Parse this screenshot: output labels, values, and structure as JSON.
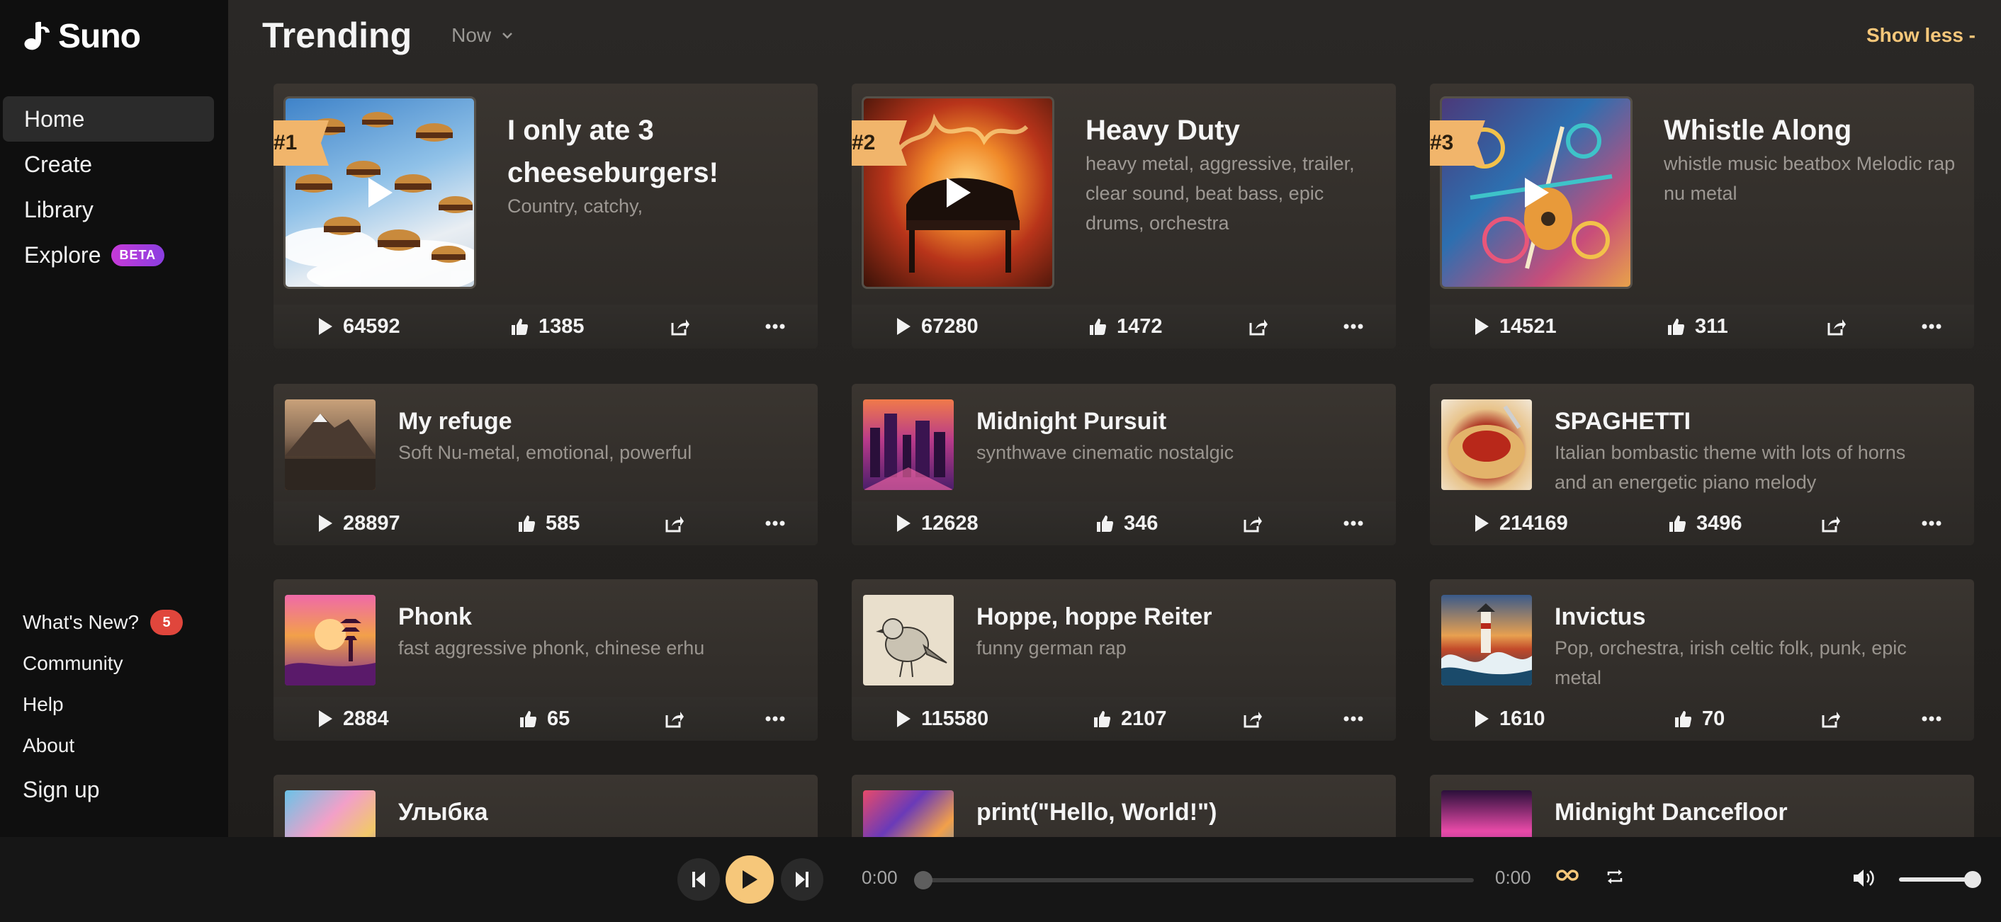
{
  "brand": {
    "name": "Suno"
  },
  "nav": [
    {
      "label": "Home",
      "active": true
    },
    {
      "label": "Create"
    },
    {
      "label": "Library"
    },
    {
      "label": "Explore",
      "badge": "BETA"
    }
  ],
  "footer_nav": {
    "whats_new": "What's New?",
    "whats_new_count": "5",
    "community": "Community",
    "help": "Help",
    "about": "About",
    "sign_up": "Sign up"
  },
  "header": {
    "title": "Trending",
    "filter": "Now",
    "show_less": "Show less -"
  },
  "featured": [
    {
      "rank": "#1",
      "title": "I only ate 3 cheeseburgers!",
      "tags": "Country, catchy,",
      "plays": "64592",
      "likes": "1385"
    },
    {
      "rank": "#2",
      "title": "Heavy Duty",
      "tags": "heavy metal, aggressive, trailer, clear sound, beat bass, epic drums, orchestra",
      "plays": "67280",
      "likes": "1472"
    },
    {
      "rank": "#3",
      "title": "Whistle Along",
      "tags": "whistle music beatbox Melodic rap nu metal",
      "plays": "14521",
      "likes": "311"
    }
  ],
  "songs": [
    {
      "title": "My refuge",
      "tags": "Soft Nu-metal, emotional, powerful",
      "plays": "28897",
      "likes": "585"
    },
    {
      "title": "Midnight Pursuit",
      "tags": "synthwave cinematic nostalgic",
      "plays": "12628",
      "likes": "346"
    },
    {
      "title": "SPAGHETTI",
      "tags": "Italian bombastic theme with lots of horns and an energetic piano melody",
      "plays": "214169",
      "likes": "3496"
    },
    {
      "title": "Phonk",
      "tags": "fast aggressive phonk, chinese erhu",
      "plays": "2884",
      "likes": "65"
    },
    {
      "title": "Hoppe, hoppe Reiter",
      "tags": "funny german rap",
      "plays": "115580",
      "likes": "2107"
    },
    {
      "title": "Invictus",
      "tags": "Pop, orchestra, irish celtic folk, punk, epic metal",
      "plays": "1610",
      "likes": "70"
    },
    {
      "title": "Улыбка",
      "tags": "",
      "plays": "",
      "likes": ""
    },
    {
      "title": "print(\"Hello, World!\")",
      "tags": "",
      "plays": "",
      "likes": ""
    },
    {
      "title": "Midnight Dancefloor",
      "tags": "",
      "plays": "",
      "likes": ""
    }
  ],
  "player": {
    "current_time": "0:00",
    "duration": "0:00",
    "progress": 0,
    "volume": 0.9
  },
  "colors": {
    "accent": "#f6c77a",
    "rank_tag": "#f1b56b",
    "badge_red": "#e0463c",
    "beta_purple": "#a33cdc"
  }
}
